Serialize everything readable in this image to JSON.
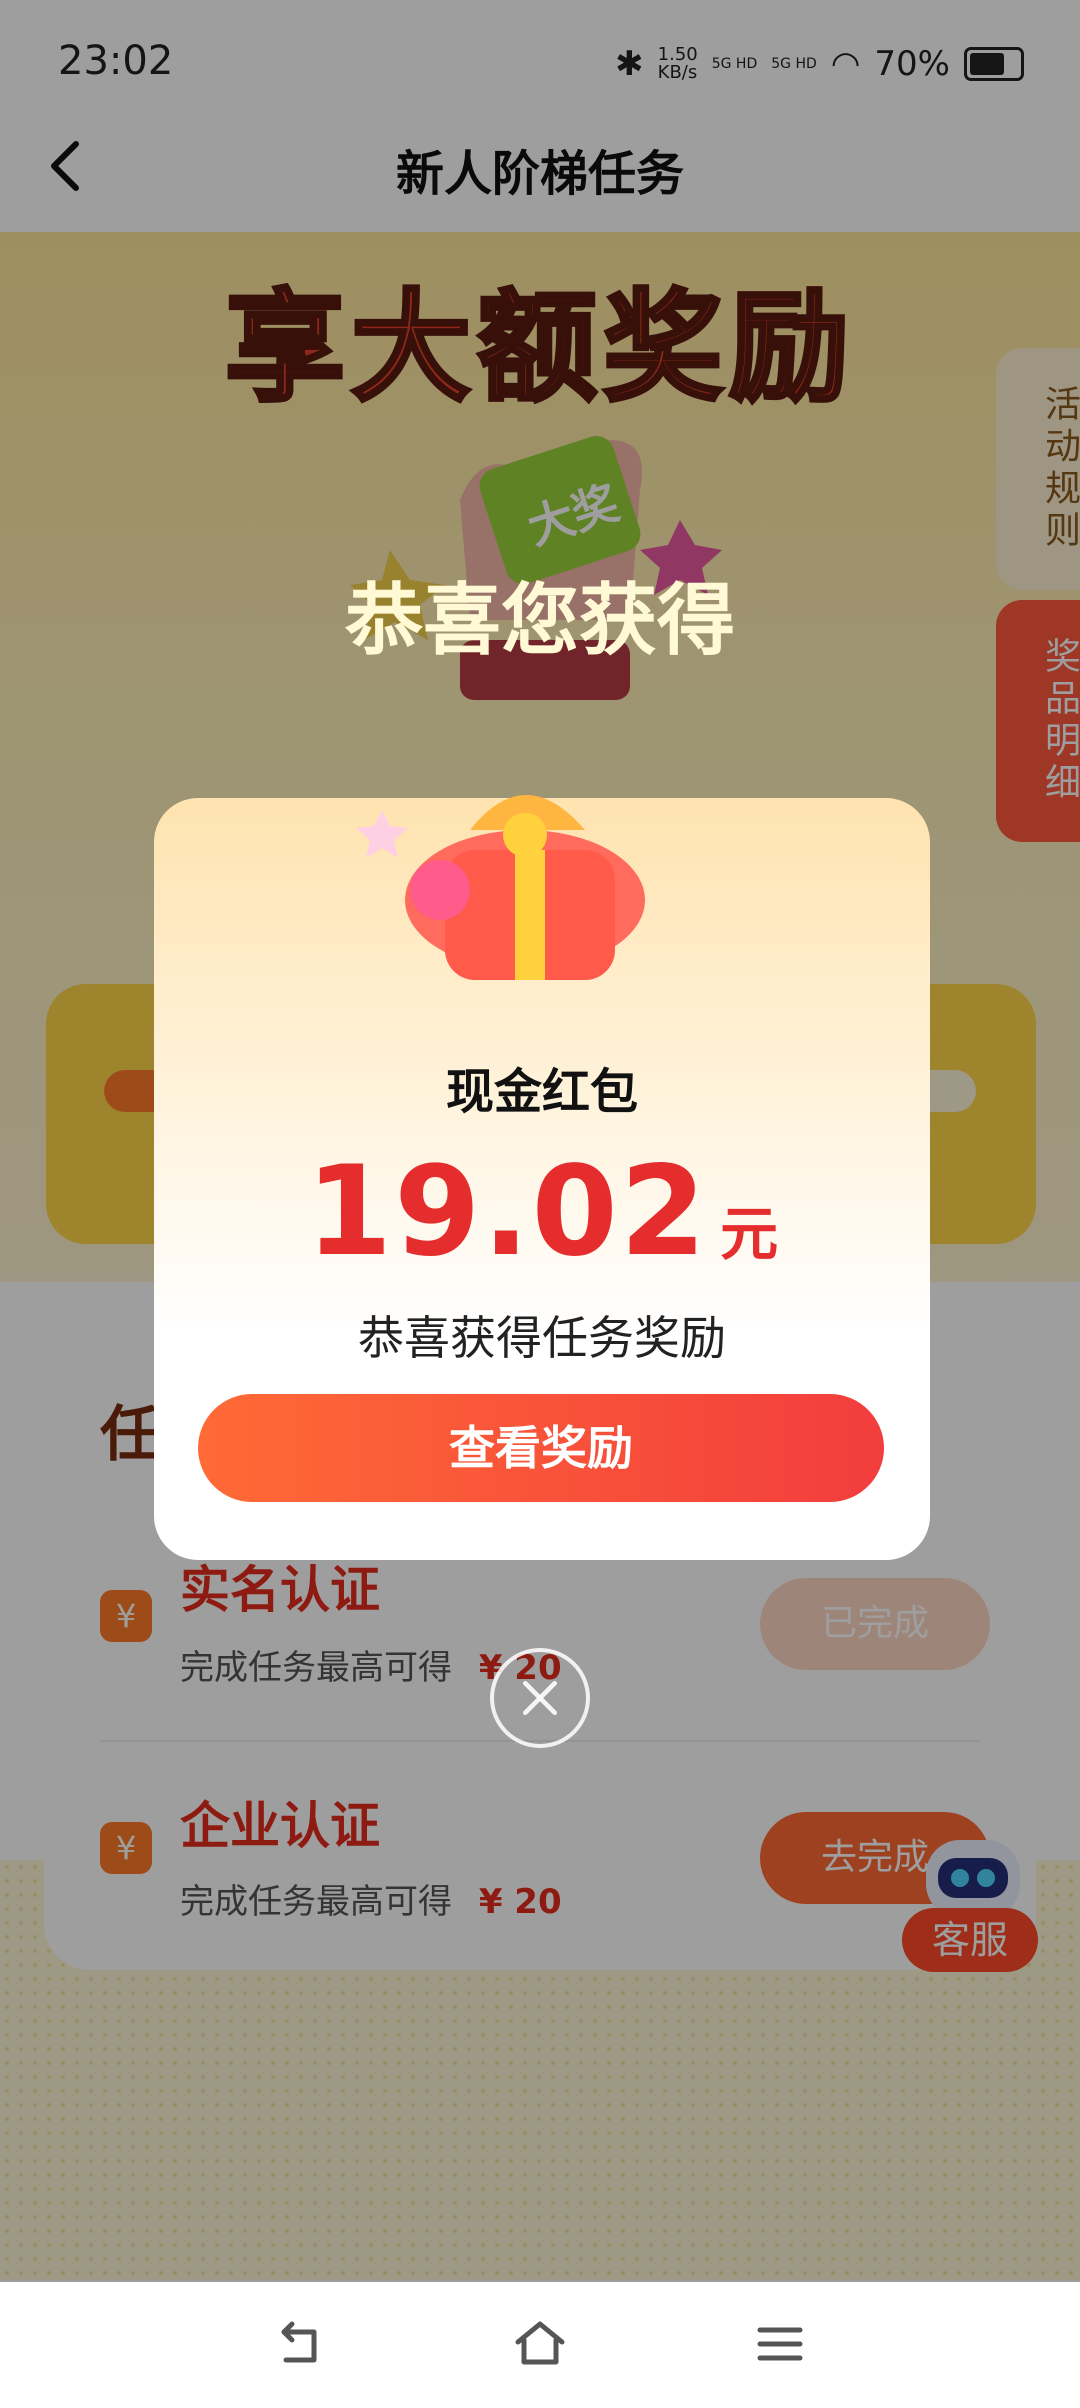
{
  "status": {
    "time": "23:02",
    "speed": "1.50\nKB/s",
    "signal1": "5G HD",
    "signal2": "5G HD",
    "battery": "70%"
  },
  "navbar": {
    "title": "新人阶梯任务"
  },
  "banner": {
    "headline": "享大额奖励",
    "hand_sign": "大奖"
  },
  "side_tabs": {
    "rules": "活动规则",
    "prizes": "奖品明细"
  },
  "tasks": {
    "header": "任",
    "items": [
      {
        "title": "实名认证",
        "subtitle": "完成任务最高可得",
        "reward": "¥ 20",
        "button": "已完成"
      },
      {
        "title": "企业认证",
        "subtitle": "完成任务最高可得",
        "reward": "¥ 20",
        "button": "去完成"
      }
    ],
    "icon_glyph": "¥"
  },
  "support": {
    "label": "客服"
  },
  "modal": {
    "congrats": "恭喜您获得",
    "type": "现金红包",
    "amount": "19.02",
    "unit": "元",
    "message": "恭喜获得任务奖励",
    "button": "查看奖励"
  },
  "colors": {
    "accent": "#f23d3d",
    "orange": "#ff6a36",
    "banner": "#ffe79a"
  }
}
